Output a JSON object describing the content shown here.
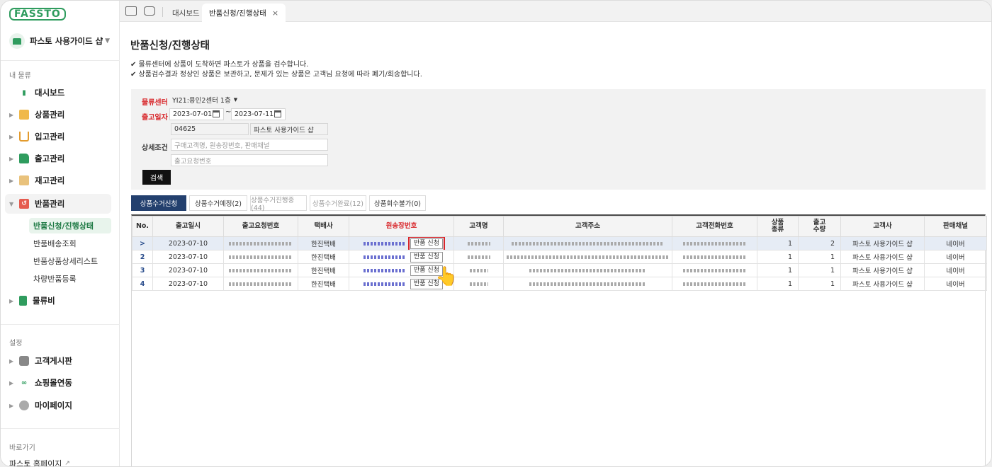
{
  "brand": {
    "logo": "FASSTO"
  },
  "sidebar": {
    "shop_name": "파스토 사용가이드 샵",
    "section_my": "내 물류",
    "items": [
      {
        "label": "대시보드"
      },
      {
        "label": "상품관리"
      },
      {
        "label": "입고관리"
      },
      {
        "label": "출고관리"
      },
      {
        "label": "재고관리"
      },
      {
        "label": "반품관리"
      },
      {
        "label": "물류비"
      }
    ],
    "sub_items": [
      {
        "label": "반품신청/진행상태"
      },
      {
        "label": "반품배송조회"
      },
      {
        "label": "반품상품상세리스트"
      },
      {
        "label": "차량반품등록"
      }
    ],
    "section_settings": "설정",
    "settings_items": [
      {
        "label": "고객게시판"
      },
      {
        "label": "쇼핑몰연동"
      },
      {
        "label": "마이페이지"
      }
    ],
    "section_shortcut": "바로가기",
    "homepage_link": "파스토 홈페이지"
  },
  "topbar": {
    "tabs": [
      {
        "label": "대시보드"
      },
      {
        "label": "반품신청/진행상태"
      }
    ],
    "close_glyph": "×"
  },
  "page": {
    "title": "반품신청/진행상태",
    "notes": [
      "✔ 물류센터에 상품이 도착하면 파스토가 상품을 검수합니다.",
      "✔ 상품검수결과 정상인 상품은 보관하고, 문제가 있는 상품은 고객님 요청에 따라 폐기/회송합니다."
    ]
  },
  "filter": {
    "center_label": "물류센터",
    "center_value": "YI21:용인2센터 1층",
    "date_label": "출고일자",
    "date_from": "2023-07-01",
    "date_to": "2023-07-11",
    "date_sep": "~",
    "customer_code": "04625",
    "customer_name": "파스토 사용가이드 샵",
    "detail_label": "상세조건",
    "detail_placeholder": "구매고객명, 원송장번호, 판매채널",
    "order_placeholder": "출고요청번호",
    "search_button": "검색"
  },
  "subtabs": [
    {
      "label": "상품수거신청",
      "state": "active"
    },
    {
      "label": "상품수거예정(2)",
      "state": "normal"
    },
    {
      "label": "상품수거진행중(44)",
      "state": "dim"
    },
    {
      "label": "상품수거완료(12)",
      "state": "dim"
    },
    {
      "label": "상품회수불가(0)",
      "state": "normal"
    }
  ],
  "grid": {
    "columns": [
      "No.",
      "출고일시",
      "출고요청번호",
      "택배사",
      "원송장번호",
      "고객명",
      "고객주소",
      "고객전화번호",
      "상품\n종류",
      "출고\n수량",
      "고객사",
      "판매채널"
    ],
    "return_button": "반품 신청",
    "rows": [
      {
        "no": ">",
        "date": "2023-07-10",
        "courier": "한진택배",
        "types": "1",
        "qty": "2",
        "client": "파스토 사용가이드 샵",
        "channel": "네이버"
      },
      {
        "no": "2",
        "date": "2023-07-10",
        "courier": "한진택배",
        "types": "1",
        "qty": "1",
        "client": "파스토 사용가이드 샵",
        "channel": "네이버"
      },
      {
        "no": "3",
        "date": "2023-07-10",
        "courier": "한진택배",
        "types": "1",
        "qty": "1",
        "client": "파스토 사용가이드 샵",
        "channel": "네이버"
      },
      {
        "no": "4",
        "date": "2023-07-10",
        "courier": "한진택배",
        "types": "1",
        "qty": "1",
        "client": "파스토 사용가이드 샵",
        "channel": "네이버"
      }
    ]
  },
  "colors": {
    "brand_green": "#2f9c5e",
    "required_red": "#d8262a",
    "active_tab_navy": "#23406e"
  }
}
